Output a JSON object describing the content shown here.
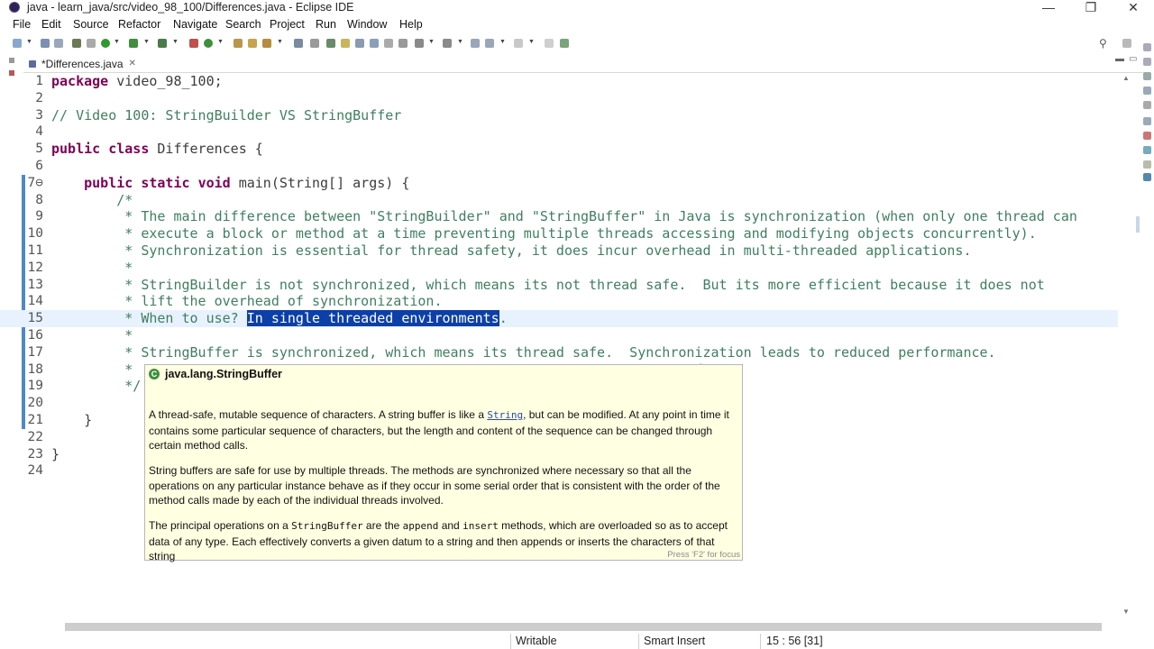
{
  "window": {
    "title": "java - learn_java/src/video_98_100/Differences.java - Eclipse IDE",
    "minimize": "—",
    "maximize": "❐",
    "close": "✕"
  },
  "menu": [
    "File",
    "Edit",
    "Source",
    "Refactor",
    "Navigate",
    "Search",
    "Project",
    "Run",
    "Window",
    "Help"
  ],
  "editor": {
    "tab_label": "*Differences.java",
    "tab_close": "✕",
    "lines": [
      {
        "n": "1",
        "text": "package video_98_100;"
      },
      {
        "n": "2",
        "text": ""
      },
      {
        "n": "3",
        "text": "// Video 100: StringBuilder VS StringBuffer"
      },
      {
        "n": "4",
        "text": ""
      },
      {
        "n": "5",
        "text": "public class Differences {"
      },
      {
        "n": "6",
        "text": ""
      },
      {
        "n": "7⊖",
        "text": "    public static void main(String[] args) {"
      },
      {
        "n": "8",
        "text": "        /*"
      },
      {
        "n": "9",
        "text": "         * The main difference between \"StringBuilder\" and \"StringBuffer\" in Java is synchronization (when only one thread can"
      },
      {
        "n": "10",
        "text": "         * execute a block or method at a time preventing multiple threads accessing and modifying objects concurrently)."
      },
      {
        "n": "11",
        "text": "         * Synchronization is essential for thread safety, it does incur overhead in multi-threaded applications."
      },
      {
        "n": "12",
        "text": "         *"
      },
      {
        "n": "13",
        "text": "         * StringBuilder is not synchronized, which means its not thread safe.  But its more efficient because it does not"
      },
      {
        "n": "14",
        "text": "         * lift the overhead of synchronization."
      },
      {
        "n": "15",
        "text": "         * When to use? ",
        "sel": "In single threaded environments",
        "after": "."
      },
      {
        "n": "16",
        "text": "         *"
      },
      {
        "n": "17",
        "text": "         * StringBuffer is synchronized, which means its thread safe.  Synchronization leads to reduced performance."
      },
      {
        "n": "18",
        "text": "         *                                                                    ed."
      },
      {
        "n": "19",
        "text": "         */"
      },
      {
        "n": "20",
        "text": ""
      },
      {
        "n": "21",
        "text": "    }"
      },
      {
        "n": "22",
        "text": ""
      },
      {
        "n": "23",
        "text": "}"
      },
      {
        "n": "24",
        "text": ""
      }
    ]
  },
  "hover": {
    "class_name": "java.lang.StringBuffer",
    "p1_a": "A thread-safe, mutable sequence of characters. A string buffer is like a ",
    "p1_link": "String",
    "p1_b": ", but can be modified. At any point in time it contains some particular sequence of characters, but the length and content of the sequence can be changed through certain method calls.",
    "p2": "String buffers are safe for use by multiple threads. The methods are synchronized where necessary so that all the operations on any particular instance behave as if they occur in some serial order that is consistent with the order of the method calls made by each of the individual threads involved.",
    "p3_a": "The principal operations on a ",
    "p3_code1": "StringBuffer",
    "p3_b": " are the ",
    "p3_code2": "append",
    "p3_c": " and ",
    "p3_code3": "insert",
    "p3_d": " methods, which are overloaded so as to accept data of any type. Each effectively converts a given datum to a string and then appends or inserts the characters of that string",
    "footer": "Press 'F2' for focus"
  },
  "status": {
    "writable": "Writable",
    "insert_mode": "Smart Insert",
    "position": "15 : 56 [31]"
  },
  "colors": {
    "keyword": "#7f0055",
    "comment": "#3f7f5f",
    "javadoc": "#3f5fbf",
    "selection": "#0c3fa8"
  }
}
